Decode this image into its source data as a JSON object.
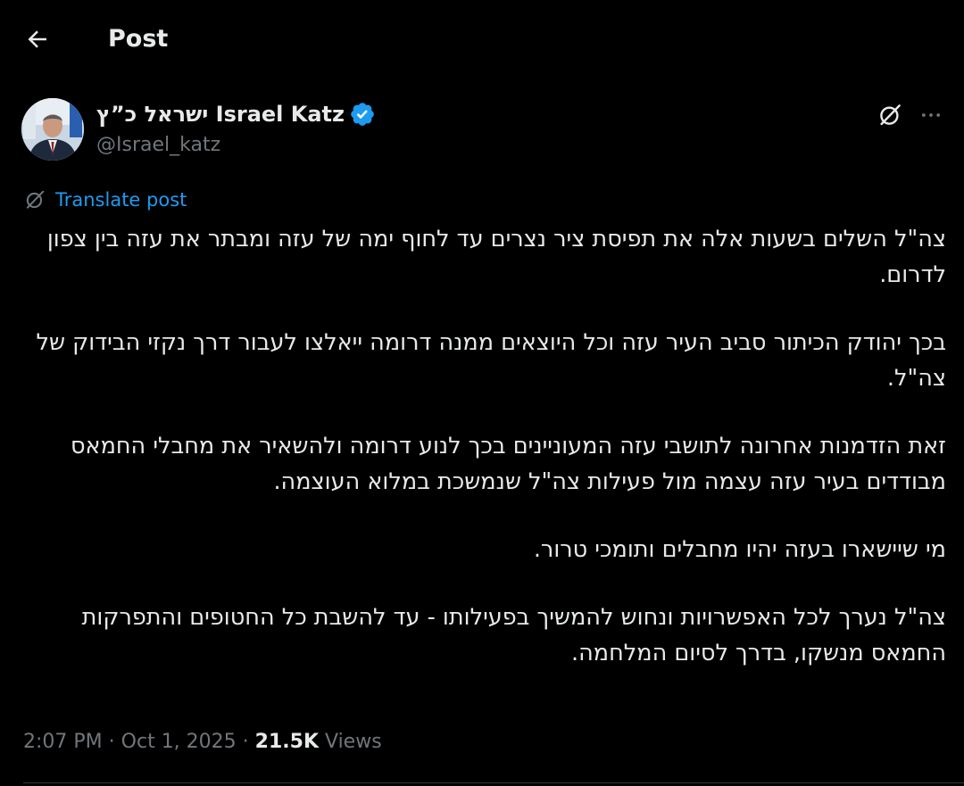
{
  "header": {
    "title": "Post",
    "back_icon": "arrow-left-icon"
  },
  "author": {
    "display_name": "ישראל כ”ץ Israel Katz",
    "handle": "@Israel_katz",
    "verified": true,
    "avatar_icon": "profile-photo"
  },
  "actions": {
    "grok_icon": "grok-icon",
    "more_icon": "more-horizontal-icon"
  },
  "translate": {
    "label": "Translate post",
    "icon": "translate-icon"
  },
  "post": {
    "paragraphs": [
      "צה\"ל השלים בשעות אלה את תפיסת ציר נצרים עד לחוף ימה של עזה ומבתר את עזה בין צפון לדרום.",
      "בכך יהודק הכיתור סביב העיר עזה וכל היוצאים ממנה דרומה ייאלצו לעבור דרך נקזי הבידוק של צה\"ל.",
      "זאת הזדמנות אחרונה לתושבי עזה המעוניינים בכך לנוע דרומה ולהשאיר את מחבלי החמאס מבודדים בעיר עזה עצמה מול פעילות צה\"ל שנמשכת במלוא העוצמה.",
      "מי שיישארו בעזה יהיו מחבלים ותומכי טרור.",
      "צה\"ל נערך לכל האפשרויות ונחוש להמשיך בפעילותו - עד להשבת כל החטופים והתפרקות החמאס מנשקו, בדרך לסיום המלחמה."
    ]
  },
  "meta": {
    "time": "2:07 PM",
    "date": "Oct 1, 2025",
    "views_count": "21.5K",
    "views_label": "Views",
    "separator": "·"
  },
  "colors": {
    "background": "#000000",
    "text": "#e7e9ea",
    "secondary": "#71767b",
    "accent": "#1d9bf0",
    "divider": "#2f3336"
  }
}
